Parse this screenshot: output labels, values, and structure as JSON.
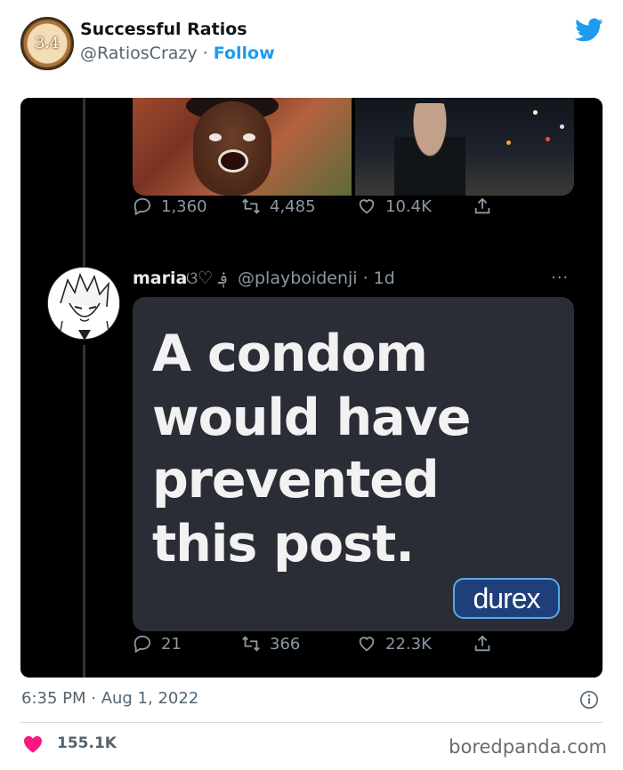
{
  "tweet": {
    "avatar_text": "3.4",
    "author_name": "Successful Ratios",
    "author_handle": "@RatiosCrazy",
    "separator": "·",
    "follow_label": "Follow",
    "timestamp": "6:35 PM · Aug 1, 2022",
    "likes": "155.1K",
    "brand_color": "#1d9bf0",
    "like_color": "#f91880"
  },
  "embedded": {
    "first_post_actions": {
      "replies": "1,360",
      "retweets": "4,485",
      "likes": "10.4K"
    },
    "reply": {
      "name": "maria",
      "deco": "ଓ♡ ؋",
      "handle": "@playboidenji · 1d",
      "more": "···",
      "image_text": [
        "A condom",
        "would have",
        "prevented",
        "this post."
      ],
      "logo_text": "durex",
      "actions": {
        "replies": "21",
        "retweets": "366",
        "likes": "22.3K"
      }
    }
  },
  "watermark": "boredpanda.com",
  "icons": {
    "twitter": "twitter-bird-icon",
    "reply": "reply-icon",
    "retweet": "retweet-icon",
    "like": "heart-outline-icon",
    "share": "share-icon",
    "info": "info-icon",
    "heart": "heart-filled-icon"
  }
}
